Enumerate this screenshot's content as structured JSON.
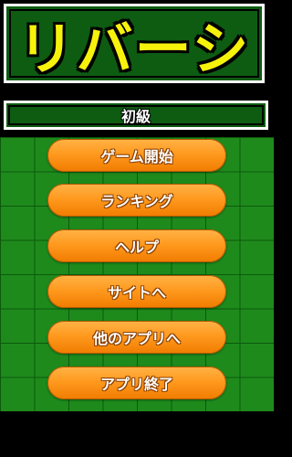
{
  "title": "リバーシ",
  "level": "初級",
  "menu": [
    "ゲーム開始",
    "ランキング",
    "ヘルプ",
    "サイトへ",
    "他のアプリへ",
    "アプリ終了"
  ],
  "colors": {
    "title_text": "#f6f20c",
    "panel_green": "#0d5c12",
    "board_green": "#1e8a1c",
    "button_orange": "#ff9a1f"
  }
}
